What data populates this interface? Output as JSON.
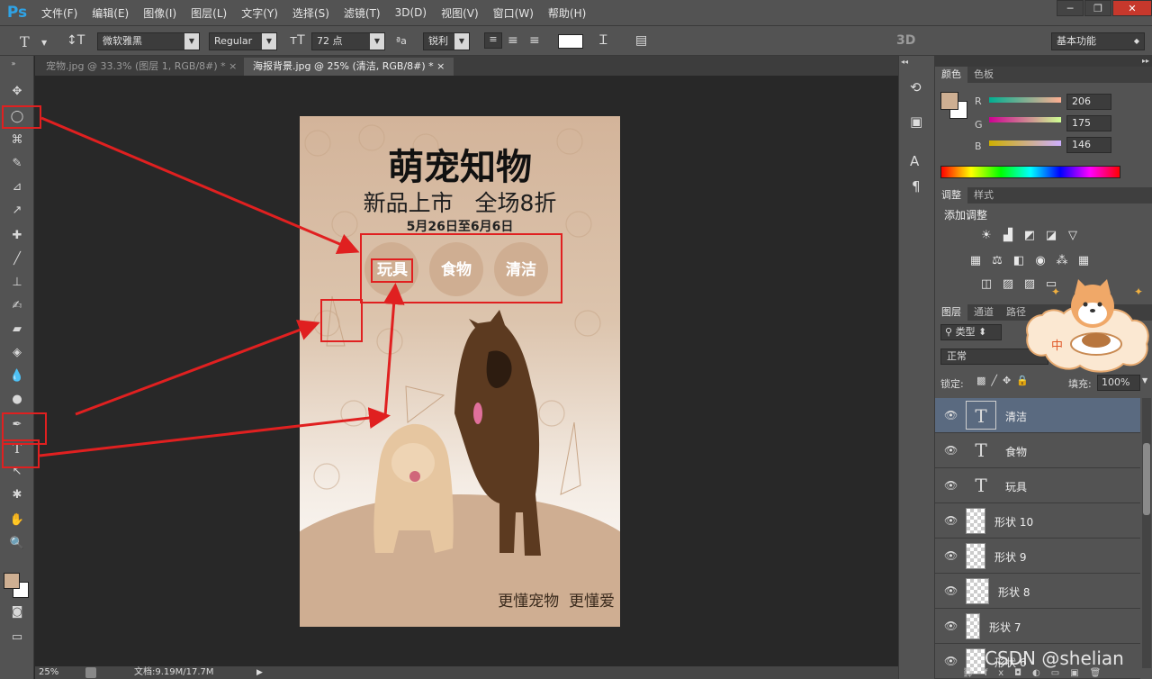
{
  "menubar": {
    "logo": "Ps",
    "items": [
      "文件(F)",
      "编辑(E)",
      "图像(I)",
      "图层(L)",
      "文字(Y)",
      "选择(S)",
      "滤镜(T)",
      "3D(D)",
      "视图(V)",
      "窗口(W)",
      "帮助(H)"
    ]
  },
  "options": {
    "font_family": "微软雅黑",
    "font_style": "Regular",
    "font_size": "72 点",
    "aa_label": "ªa",
    "antialias": "锐利",
    "three_d": "3D",
    "workspace": "基本功能"
  },
  "tabs": [
    {
      "label": "宠物.jpg @ 33.3% (图层 1, RGB/8#) *",
      "close": "×"
    },
    {
      "label": "海报背景.jpg @ 25% (清洁, RGB/8#) *",
      "close": "×"
    }
  ],
  "poster": {
    "title": "萌宠知物",
    "subtitle": "新品上市   全场8折",
    "date": "5月26日至6月6日",
    "circles": [
      "玩具",
      "食物",
      "清洁"
    ],
    "slogan": "更懂宠物  更懂爱"
  },
  "status": {
    "zoom": "25%",
    "doc": "文档:9.19M/17.7M"
  },
  "color_panel": {
    "tabs": [
      "颜色",
      "色板"
    ],
    "r_label": "R",
    "r": "206",
    "g_label": "G",
    "g": "175",
    "b_label": "B",
    "b": "146",
    "fg_color": "#ceaf92"
  },
  "adjust_panel": {
    "tabs": [
      "调整",
      "样式"
    ],
    "heading": "添加调整"
  },
  "layers_panel": {
    "tabs": [
      "图层",
      "通道",
      "路径"
    ],
    "filter": "类型",
    "blend": "正常",
    "lock_label": "锁定:",
    "fill_label": "填充:",
    "fill_value": "100%",
    "layers": [
      {
        "name": "清洁",
        "type": "text",
        "selected": true
      },
      {
        "name": "食物",
        "type": "text",
        "selected": false
      },
      {
        "name": "玩具",
        "type": "text",
        "selected": false
      },
      {
        "name": "形状 10",
        "type": "shape",
        "selected": false
      },
      {
        "name": "形状 9",
        "type": "shape",
        "selected": false
      },
      {
        "name": "形状 8",
        "type": "shape",
        "selected": false
      },
      {
        "name": "形状 7",
        "type": "shape",
        "selected": false
      },
      {
        "name": "形状 6",
        "type": "shape",
        "selected": false
      }
    ]
  },
  "sticker": {
    "text": "中"
  },
  "watermark": "CSDN @shelian"
}
